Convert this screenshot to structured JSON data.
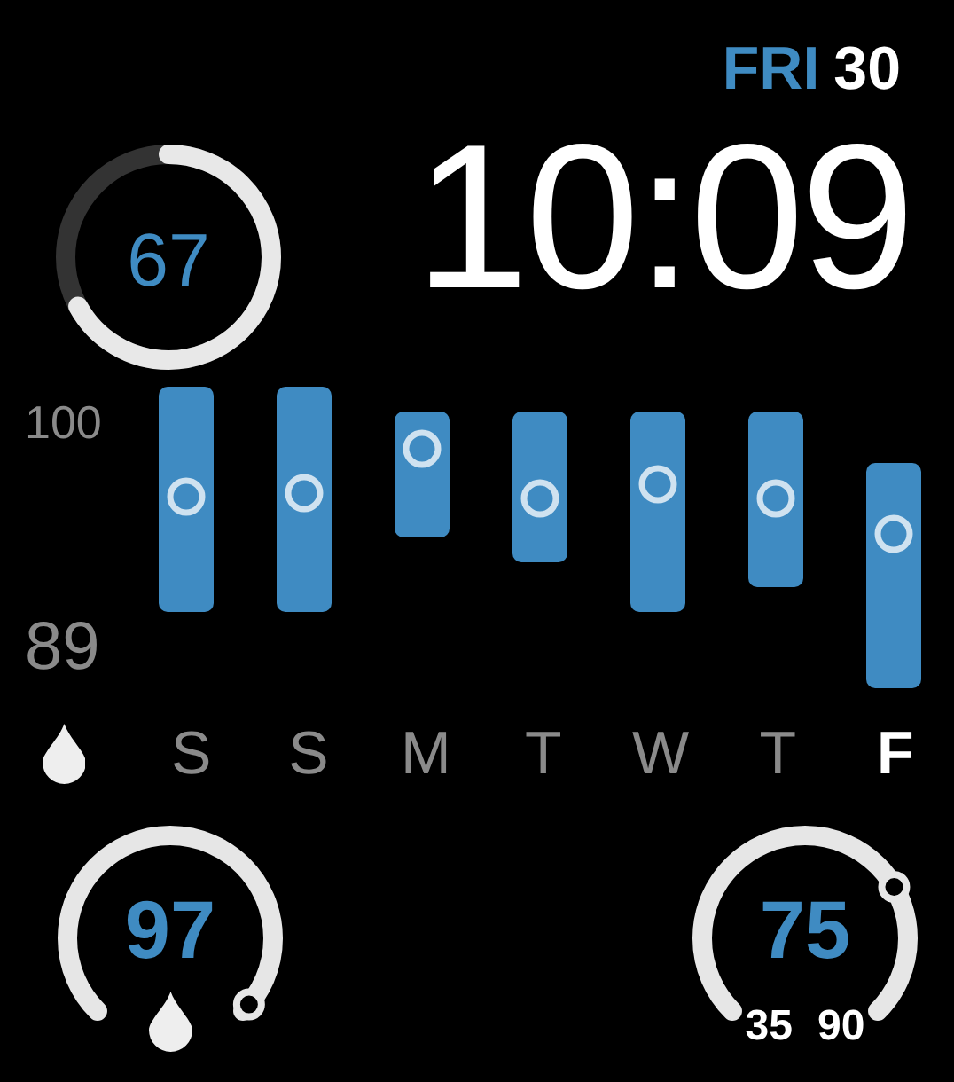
{
  "date": {
    "weekday": "FRI",
    "day": "30"
  },
  "time": "10:09",
  "ring": {
    "value": "67",
    "level": 0.67
  },
  "chart": {
    "y_labels": [
      "100",
      "89"
    ],
    "days": [
      {
        "label": "S",
        "selected": false
      },
      {
        "label": "S",
        "selected": false
      },
      {
        "label": "M",
        "selected": false
      },
      {
        "label": "T",
        "selected": false
      },
      {
        "label": "W",
        "selected": false
      },
      {
        "label": "T",
        "selected": false
      },
      {
        "label": "F",
        "selected": true
      }
    ]
  },
  "humidity_gauge": {
    "value": "97"
  },
  "temperature_gauge": {
    "value": "75",
    "min": "35",
    "max": "90"
  }
}
